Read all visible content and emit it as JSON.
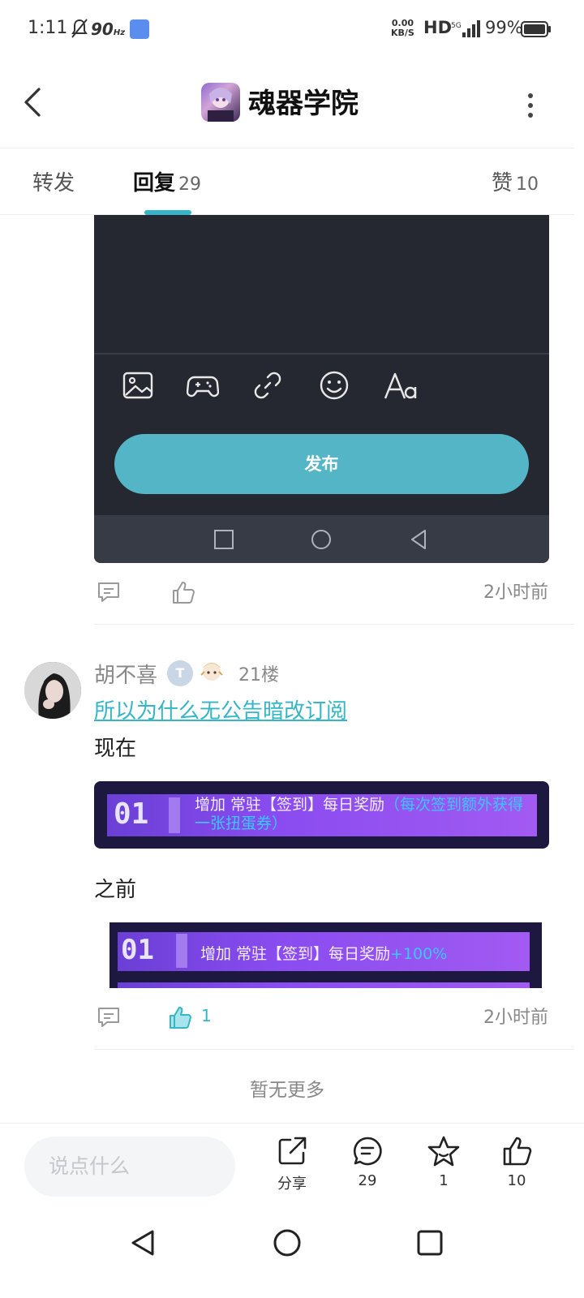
{
  "status_bar": {
    "time": "1:11",
    "refresh_rate": "90",
    "refresh_unit": "Hz",
    "net_speed_value": "0.00",
    "net_speed_unit": "KB/S",
    "hd": "HD",
    "network": "5G",
    "battery": "99%"
  },
  "header": {
    "title": "魂器学院",
    "icons": [
      "back-icon",
      "app-icon",
      "more-icon"
    ]
  },
  "tabs": [
    {
      "label": "转发",
      "count": ""
    },
    {
      "label": "回复",
      "count": "29"
    },
    {
      "label": "赞",
      "count": "10"
    }
  ],
  "editor_screenshot": {
    "tools": [
      "image-icon",
      "gamepad-icon",
      "link-icon",
      "emoji-icon",
      "font-icon"
    ],
    "publish_label": "发布"
  },
  "comment_20": {
    "time": "2小时前",
    "like_count": ""
  },
  "comment_21": {
    "username": "胡不喜",
    "badge_letter": "T",
    "floor": "21楼",
    "link_text": "所以为什么无公告暗改订阅",
    "text_now": "现在",
    "promo_now": {
      "number": "01",
      "text": "增加 常驻【签到】每日奖励",
      "highlight": "（每次签到额外获得一张扭蛋券）"
    },
    "text_before": "之前",
    "promo_before": {
      "number": "01",
      "text": "增加 常驻【签到】每日奖励",
      "highlight": "+100%"
    },
    "time": "2小时前",
    "like_count": "1"
  },
  "no_more": "暂无更多",
  "bottom_bar": {
    "comment_placeholder": "说点什么",
    "share_label": "分享",
    "comment_count": "29",
    "favorite_count": "1",
    "like_count": "10"
  },
  "colors": {
    "accent": "#35b5c6",
    "publish_button": "#54b5c6",
    "editor_bg": "#252830"
  }
}
